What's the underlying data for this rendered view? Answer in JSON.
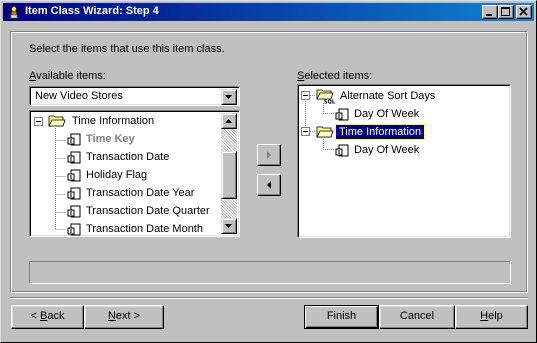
{
  "window": {
    "title": "Item Class Wizard: Step 4",
    "controls": [
      "minimize-icon",
      "maximize-icon",
      "close-icon"
    ]
  },
  "instructions": "Select the items that use this item class.",
  "available": {
    "label_accel": "A",
    "label_rest": "vailable items:",
    "combo_value": "New Video Stores",
    "tree": [
      {
        "label": "Time Information",
        "type": "folder",
        "expanded": true,
        "level": 0
      },
      {
        "label": "Time Key",
        "type": "item",
        "level": 1,
        "disabled": true
      },
      {
        "label": "Transaction Date",
        "type": "item",
        "level": 1
      },
      {
        "label": "Holiday Flag",
        "type": "item",
        "level": 1
      },
      {
        "label": "Transaction Date Year",
        "type": "item",
        "level": 1
      },
      {
        "label": "Transaction Date Quarter",
        "type": "item",
        "level": 1
      },
      {
        "label": "Transaction Date Month",
        "type": "item",
        "level": 1
      }
    ]
  },
  "selected": {
    "label_accel": "S",
    "label_rest": "elected items:",
    "tree": [
      {
        "label": "Alternate Sort Days",
        "type": "sql-folder",
        "expanded": true,
        "level": 0
      },
      {
        "label": "Day Of Week",
        "type": "item",
        "level": 1
      },
      {
        "label": "Time Information",
        "type": "folder",
        "expanded": true,
        "level": 0,
        "selected": true
      },
      {
        "label": "Day Of Week",
        "type": "item",
        "level": 1
      }
    ]
  },
  "buttons": {
    "back_accel": "B",
    "back_prefix": "< ",
    "back_rest": "ack",
    "next_accel": "N",
    "next_rest": "ext >",
    "finish": "Finish",
    "cancel": "Cancel",
    "help_accel": "H",
    "help_rest": "elp"
  },
  "colors": {
    "face": "#c0c0c0",
    "title_start": "#000080",
    "title_end": "#1084d0",
    "selection": "#000080",
    "folder": "#ffff80"
  }
}
